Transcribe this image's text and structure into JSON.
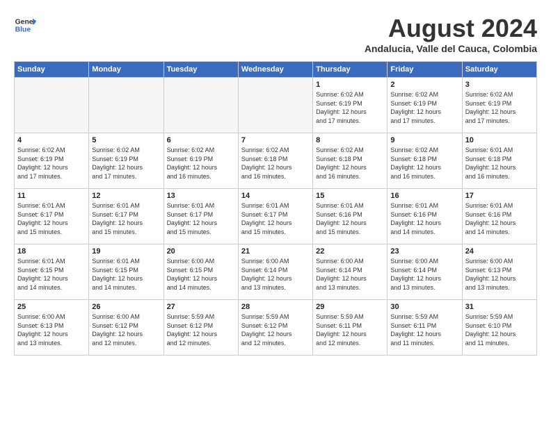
{
  "header": {
    "logo_line1": "General",
    "logo_line2": "Blue",
    "month_title": "August 2024",
    "subtitle": "Andalucia, Valle del Cauca, Colombia"
  },
  "weekdays": [
    "Sunday",
    "Monday",
    "Tuesday",
    "Wednesday",
    "Thursday",
    "Friday",
    "Saturday"
  ],
  "weeks": [
    [
      {
        "day": "",
        "info": ""
      },
      {
        "day": "",
        "info": ""
      },
      {
        "day": "",
        "info": ""
      },
      {
        "day": "",
        "info": ""
      },
      {
        "day": "1",
        "info": "Sunrise: 6:02 AM\nSunset: 6:19 PM\nDaylight: 12 hours\nand 17 minutes."
      },
      {
        "day": "2",
        "info": "Sunrise: 6:02 AM\nSunset: 6:19 PM\nDaylight: 12 hours\nand 17 minutes."
      },
      {
        "day": "3",
        "info": "Sunrise: 6:02 AM\nSunset: 6:19 PM\nDaylight: 12 hours\nand 17 minutes."
      }
    ],
    [
      {
        "day": "4",
        "info": "Sunrise: 6:02 AM\nSunset: 6:19 PM\nDaylight: 12 hours\nand 17 minutes."
      },
      {
        "day": "5",
        "info": "Sunrise: 6:02 AM\nSunset: 6:19 PM\nDaylight: 12 hours\nand 17 minutes."
      },
      {
        "day": "6",
        "info": "Sunrise: 6:02 AM\nSunset: 6:19 PM\nDaylight: 12 hours\nand 16 minutes."
      },
      {
        "day": "7",
        "info": "Sunrise: 6:02 AM\nSunset: 6:18 PM\nDaylight: 12 hours\nand 16 minutes."
      },
      {
        "day": "8",
        "info": "Sunrise: 6:02 AM\nSunset: 6:18 PM\nDaylight: 12 hours\nand 16 minutes."
      },
      {
        "day": "9",
        "info": "Sunrise: 6:02 AM\nSunset: 6:18 PM\nDaylight: 12 hours\nand 16 minutes."
      },
      {
        "day": "10",
        "info": "Sunrise: 6:01 AM\nSunset: 6:18 PM\nDaylight: 12 hours\nand 16 minutes."
      }
    ],
    [
      {
        "day": "11",
        "info": "Sunrise: 6:01 AM\nSunset: 6:17 PM\nDaylight: 12 hours\nand 15 minutes."
      },
      {
        "day": "12",
        "info": "Sunrise: 6:01 AM\nSunset: 6:17 PM\nDaylight: 12 hours\nand 15 minutes."
      },
      {
        "day": "13",
        "info": "Sunrise: 6:01 AM\nSunset: 6:17 PM\nDaylight: 12 hours\nand 15 minutes."
      },
      {
        "day": "14",
        "info": "Sunrise: 6:01 AM\nSunset: 6:17 PM\nDaylight: 12 hours\nand 15 minutes."
      },
      {
        "day": "15",
        "info": "Sunrise: 6:01 AM\nSunset: 6:16 PM\nDaylight: 12 hours\nand 15 minutes."
      },
      {
        "day": "16",
        "info": "Sunrise: 6:01 AM\nSunset: 6:16 PM\nDaylight: 12 hours\nand 14 minutes."
      },
      {
        "day": "17",
        "info": "Sunrise: 6:01 AM\nSunset: 6:16 PM\nDaylight: 12 hours\nand 14 minutes."
      }
    ],
    [
      {
        "day": "18",
        "info": "Sunrise: 6:01 AM\nSunset: 6:15 PM\nDaylight: 12 hours\nand 14 minutes."
      },
      {
        "day": "19",
        "info": "Sunrise: 6:01 AM\nSunset: 6:15 PM\nDaylight: 12 hours\nand 14 minutes."
      },
      {
        "day": "20",
        "info": "Sunrise: 6:00 AM\nSunset: 6:15 PM\nDaylight: 12 hours\nand 14 minutes."
      },
      {
        "day": "21",
        "info": "Sunrise: 6:00 AM\nSunset: 6:14 PM\nDaylight: 12 hours\nand 13 minutes."
      },
      {
        "day": "22",
        "info": "Sunrise: 6:00 AM\nSunset: 6:14 PM\nDaylight: 12 hours\nand 13 minutes."
      },
      {
        "day": "23",
        "info": "Sunrise: 6:00 AM\nSunset: 6:14 PM\nDaylight: 12 hours\nand 13 minutes."
      },
      {
        "day": "24",
        "info": "Sunrise: 6:00 AM\nSunset: 6:13 PM\nDaylight: 12 hours\nand 13 minutes."
      }
    ],
    [
      {
        "day": "25",
        "info": "Sunrise: 6:00 AM\nSunset: 6:13 PM\nDaylight: 12 hours\nand 13 minutes."
      },
      {
        "day": "26",
        "info": "Sunrise: 6:00 AM\nSunset: 6:12 PM\nDaylight: 12 hours\nand 12 minutes."
      },
      {
        "day": "27",
        "info": "Sunrise: 5:59 AM\nSunset: 6:12 PM\nDaylight: 12 hours\nand 12 minutes."
      },
      {
        "day": "28",
        "info": "Sunrise: 5:59 AM\nSunset: 6:12 PM\nDaylight: 12 hours\nand 12 minutes."
      },
      {
        "day": "29",
        "info": "Sunrise: 5:59 AM\nSunset: 6:11 PM\nDaylight: 12 hours\nand 12 minutes."
      },
      {
        "day": "30",
        "info": "Sunrise: 5:59 AM\nSunset: 6:11 PM\nDaylight: 12 hours\nand 11 minutes."
      },
      {
        "day": "31",
        "info": "Sunrise: 5:59 AM\nSunset: 6:10 PM\nDaylight: 12 hours\nand 11 minutes."
      }
    ]
  ]
}
